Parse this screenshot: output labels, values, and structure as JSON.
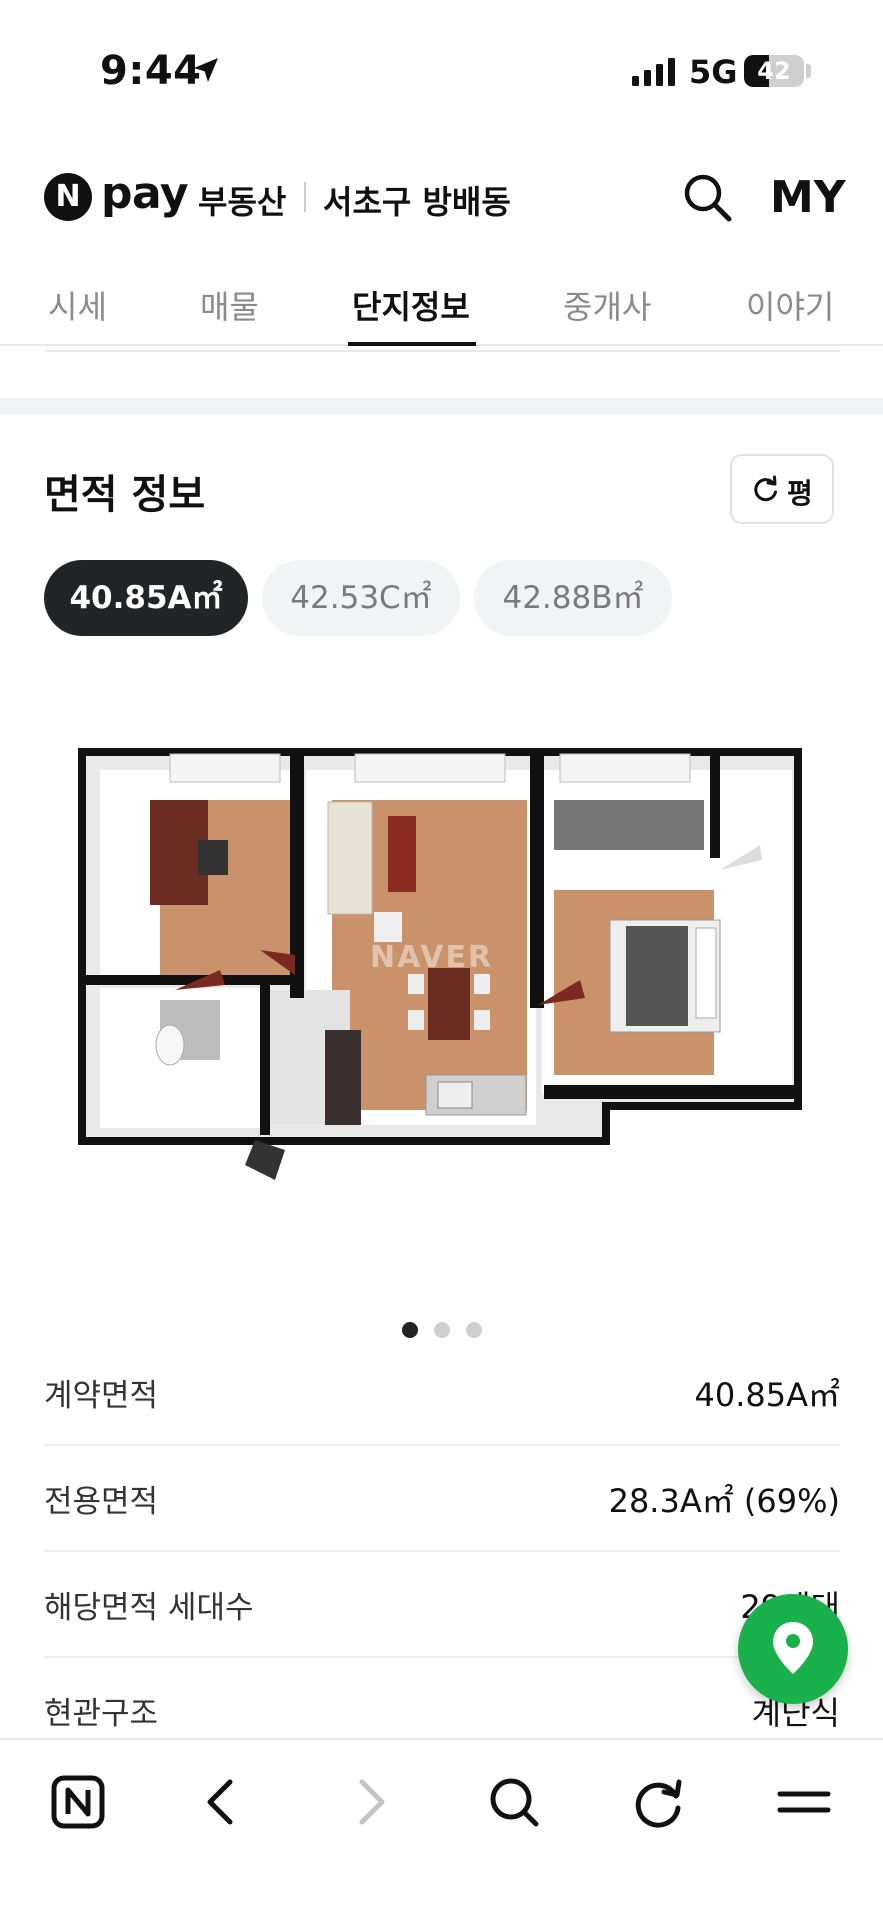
{
  "status_bar": {
    "time": "9:44",
    "network": "5G",
    "battery": "42",
    "battery_level": 0.42
  },
  "header": {
    "logo_letter": "N",
    "brand": "pay",
    "service": "부동산",
    "region": "서초구 방배동",
    "my_label": "MY"
  },
  "tabs": [
    {
      "label": "시세",
      "active": false
    },
    {
      "label": "매물",
      "active": false
    },
    {
      "label": "단지정보",
      "active": true
    },
    {
      "label": "중개사",
      "active": false
    },
    {
      "label": "이야기",
      "active": false
    }
  ],
  "area_section": {
    "title": "면적 정보",
    "unit_toggle_label": "평",
    "chips": [
      {
        "label": "40.85A㎡",
        "selected": true
      },
      {
        "label": "42.53C㎡",
        "selected": false
      },
      {
        "label": "42.88B㎡",
        "selected": false
      }
    ],
    "floorplan_watermark": "NAVER",
    "carousel": {
      "total": 3,
      "current": 1
    }
  },
  "info_rows": [
    {
      "label": "계약면적",
      "value": "40.85A㎡"
    },
    {
      "label": "전용면적",
      "value": "28.3A㎡ (69%)"
    },
    {
      "label": "해당면적 세대수",
      "value": "29세대"
    },
    {
      "label": "현관구조",
      "value": "계단식"
    }
  ],
  "icons": {
    "location": "location-arrow-icon",
    "search": "search-icon",
    "refresh": "refresh-icon",
    "map_pin": "map-pin-icon",
    "bottom": [
      "naver-home-icon",
      "back-arrow-icon",
      "forward-arrow-icon",
      "search-icon",
      "reload-icon",
      "menu-icon"
    ]
  },
  "colors": {
    "accent_green": "#19b14b",
    "chip_active_bg": "#222427",
    "chip_inactive_bg": "#f2f3f5"
  }
}
